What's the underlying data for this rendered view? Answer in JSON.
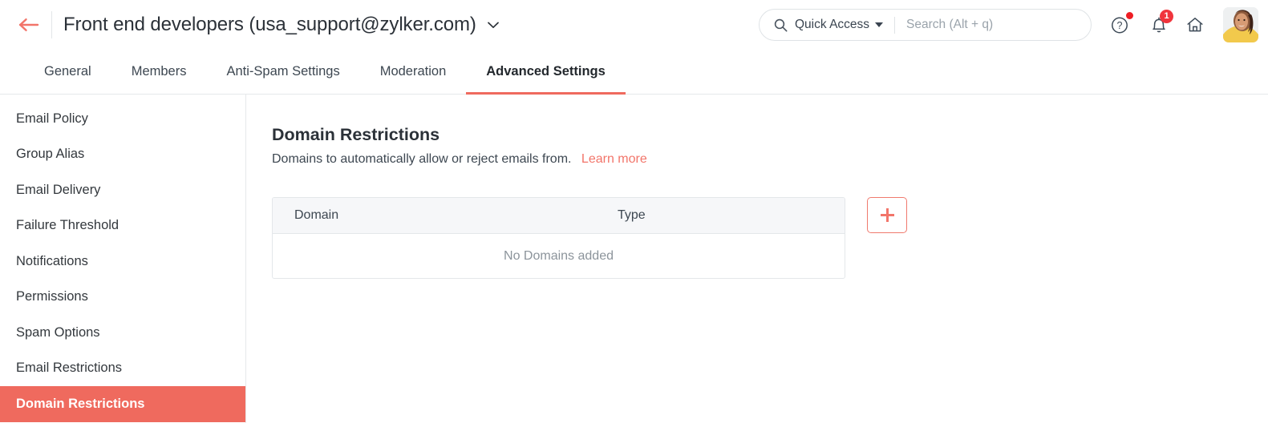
{
  "colors": {
    "accent": "#ef6a5e",
    "link": "#f2756a",
    "badge": "#f0353d",
    "dot": "#ee1d24",
    "text": "#2b3138",
    "muted": "#8c949b",
    "border": "#e6e8ea",
    "table_header_bg": "#f6f7f9"
  },
  "header": {
    "back_icon": "arrow-left-icon",
    "title": "Front end developers (usa_support@zylker.com)",
    "title_chevron_icon": "chevron-down-icon",
    "search": {
      "search_icon": "search-icon",
      "scope_label": "Quick Access",
      "scope_caret_icon": "caret-down-icon",
      "placeholder": "Search (Alt + q)",
      "value": ""
    },
    "help_icon": "question-circle-icon",
    "help_has_alert_dot": true,
    "bell_icon": "bell-icon",
    "bell_badge": "1",
    "home_icon": "home-icon",
    "avatar_name": "user-avatar"
  },
  "tabs": [
    {
      "label": "General",
      "active": false
    },
    {
      "label": "Members",
      "active": false
    },
    {
      "label": "Anti-Spam Settings",
      "active": false
    },
    {
      "label": "Moderation",
      "active": false
    },
    {
      "label": "Advanced Settings",
      "active": true
    }
  ],
  "sidebar": {
    "items": [
      {
        "label": "Email Policy",
        "active": false
      },
      {
        "label": "Group Alias",
        "active": false
      },
      {
        "label": "Email Delivery",
        "active": false
      },
      {
        "label": "Failure Threshold",
        "active": false
      },
      {
        "label": "Notifications",
        "active": false
      },
      {
        "label": "Permissions",
        "active": false
      },
      {
        "label": "Spam Options",
        "active": false
      },
      {
        "label": "Email Restrictions",
        "active": false
      },
      {
        "label": "Domain Restrictions",
        "active": true
      }
    ]
  },
  "main": {
    "title": "Domain Restrictions",
    "description": "Domains to automatically allow or reject emails from.",
    "learn_more_label": "Learn more",
    "table": {
      "columns": [
        "Domain",
        "Type"
      ],
      "rows": [],
      "empty_message": "No Domains added"
    },
    "add_button": {
      "icon": "plus-icon",
      "label": "+"
    }
  }
}
